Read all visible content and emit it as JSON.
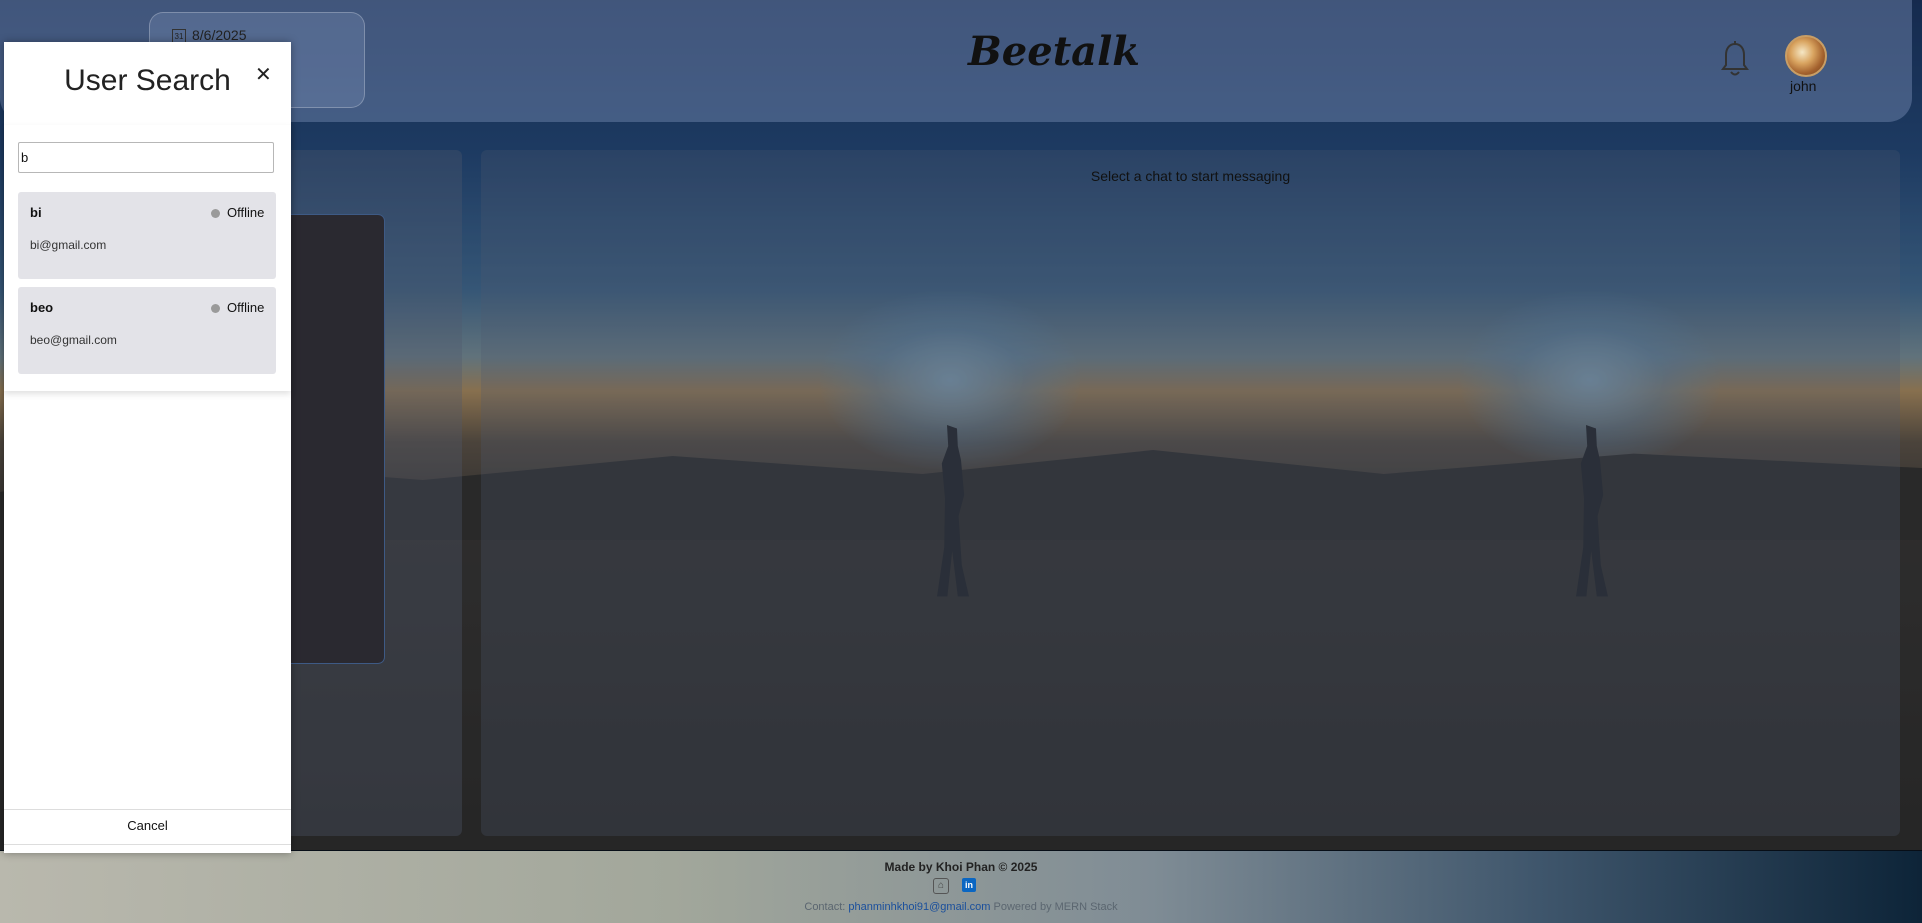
{
  "header": {
    "date": "8/6/2025",
    "brand": "Beetalk",
    "username": "john"
  },
  "chat": {
    "placeholder_text": "Select a chat to start messaging"
  },
  "modal": {
    "title": "User Search",
    "search_value": "b",
    "results": [
      {
        "name": "bi",
        "status": "Offline",
        "email": "bi@gmail.com"
      },
      {
        "name": "beo",
        "status": "Offline",
        "email": "beo@gmail.com"
      }
    ],
    "cancel_label": "Cancel"
  },
  "footer": {
    "made_by": "Made by Khoi Phan © 2025",
    "contact_label": "Contact:",
    "contact_email": "phanminhkhoi91@gmail.com",
    "powered_by": "Powered by MERN Stack"
  },
  "icons": {
    "bell": "bell-icon",
    "calendar": "calendar-icon",
    "close": "close-icon",
    "github": "github-icon",
    "linkedin": "linkedin-icon"
  },
  "colors": {
    "status_offline": "#9a9a9a",
    "linkedin": "#0a66c2"
  }
}
